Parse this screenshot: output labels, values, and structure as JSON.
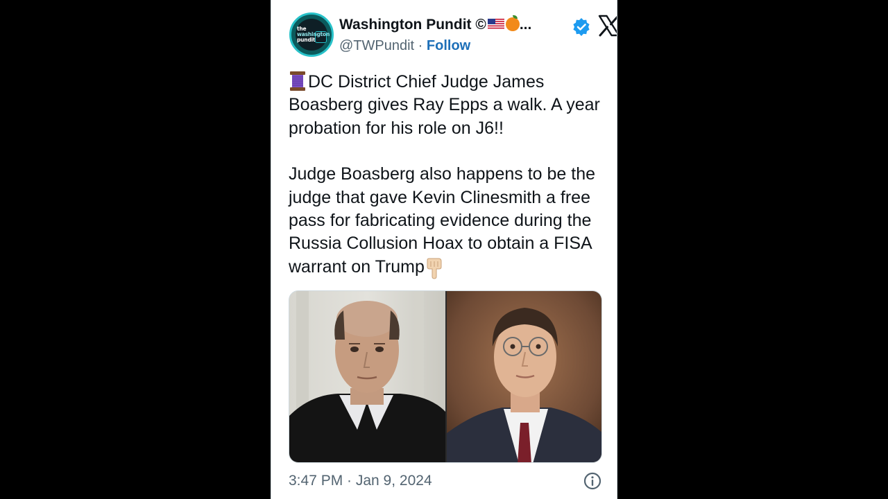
{
  "tweet": {
    "author": {
      "display_name": "Washington Pundit ©",
      "name_overflow": "...",
      "handle": "@TWPundit",
      "separator": "·",
      "follow_label": "Follow",
      "avatar_logo": [
        "the",
        "washington",
        "pundit"
      ],
      "verified": true,
      "badge_icon": "verified-badge-icon",
      "emojis": [
        "us-flag-icon",
        "orange-emoji-icon"
      ]
    },
    "platform_icon": "x-logo-icon",
    "text": {
      "lead_emoji": "thread-spool-icon",
      "paragraph_1": "DC District Chief Judge James Boasberg gives Ray Epps a walk. A year probation for his role on J6!!",
      "paragraph_2": "Judge Boasberg also happens to be the judge that gave Kevin Clinesmith a free pass for fabricating evidence during the Russia Collusion Hoax to obtain a FISA warrant  on Trump",
      "trailing_emoji": "pointing-down-icon"
    },
    "media": {
      "photos": [
        "judge-photo",
        "man-in-suit-photo"
      ]
    },
    "timestamp": "3:47 PM · Jan 9, 2024",
    "info_icon": "info-icon"
  },
  "colors": {
    "background": "#000000",
    "card": "#ffffff",
    "text_primary": "#0f1419",
    "text_secondary": "#536471",
    "link": "#1d6fb8",
    "verified": "#1d9bf0"
  }
}
